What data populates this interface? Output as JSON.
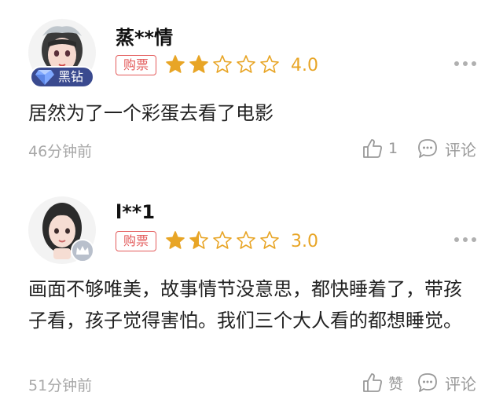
{
  "reviews": [
    {
      "username": "蒸**情",
      "badge_vip": "黑钻",
      "ticket_label": "购票",
      "stars": [
        1,
        1,
        0,
        0,
        0
      ],
      "score": "4.0",
      "comment": "居然为了一个彩蛋去看了电影",
      "time": "46分钟前",
      "like_count": "1",
      "reply_label": "评论"
    },
    {
      "username": "l**1",
      "ticket_label": "购票",
      "stars": [
        1,
        0.5,
        0,
        0,
        0
      ],
      "score": "3.0",
      "comment": "画面不够唯美，故事情节没意思，都快睡着了，带孩子看，孩子觉得害怕。我们三个大人看的都想睡觉。",
      "time": "51分钟前",
      "like_label": "赞",
      "reply_label": "评论"
    }
  ],
  "colors": {
    "star_filled": "#e8a526",
    "star_empty_stroke": "#e8a526",
    "ticket_badge": "#e35b5b",
    "vip_badge_bg": "#3a4a8f",
    "meta_text": "#a8a8a8"
  },
  "icons": {
    "more": "more-dots-icon",
    "like": "thumbs-up-icon",
    "reply": "speech-bubble-icon",
    "vip": "diamond-icon",
    "level": "crown-icon"
  }
}
